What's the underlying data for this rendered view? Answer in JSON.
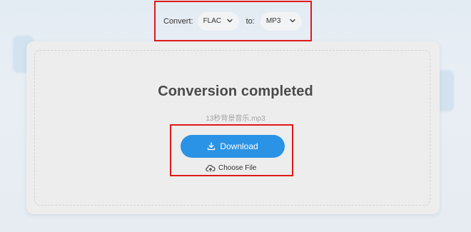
{
  "converter": {
    "convert_label": "Convert:",
    "from_format": "FLAC",
    "to_label": "to:",
    "to_format": "MP3"
  },
  "result": {
    "title": "Conversion completed",
    "filename": "13秒背景音乐.mp3",
    "download_label": "Download",
    "choose_file_label": "Choose File"
  },
  "colors": {
    "accent": "#2b93e6",
    "highlight_border": "#e0191a",
    "card_bg": "#ededed"
  },
  "icons": {
    "dropdown": "chevron-down-icon",
    "download": "download-icon",
    "upload": "cloud-upload-icon"
  }
}
